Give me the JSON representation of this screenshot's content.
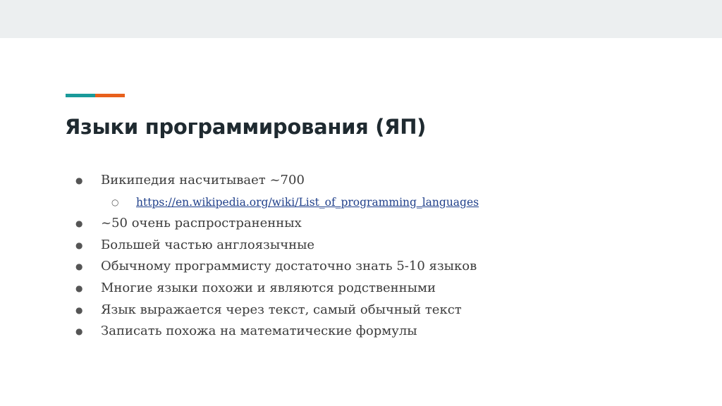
{
  "colors": {
    "accent_primary": "#1a9a9a",
    "accent_secondary": "#e8601c",
    "top_strip": "#eceff0",
    "title": "#1f2a30",
    "body_text": "#3c3c3c",
    "link": "#1f3f8a"
  },
  "slide": {
    "title": "Языки программирования (ЯП)",
    "bullets": [
      {
        "text": "Википедия насчитывает ~700",
        "sub": [
          {
            "text": "https://en.wikipedia.org/wiki/List_of_programming_languages",
            "is_link": true
          }
        ]
      },
      {
        "text": "~50 очень распространенных"
      },
      {
        "text": "Большей частью англоязычные"
      },
      {
        "text": "Обычному программисту достаточно знать 5-10 языков"
      },
      {
        "text": "Многие языки похожи и являются родственными"
      },
      {
        "text": "Язык выражается через текст, самый обычный текст"
      },
      {
        "text": "Записать похожа на математические формулы"
      }
    ],
    "bullet_glyph": "●",
    "sub_bullet_glyph": "○"
  }
}
